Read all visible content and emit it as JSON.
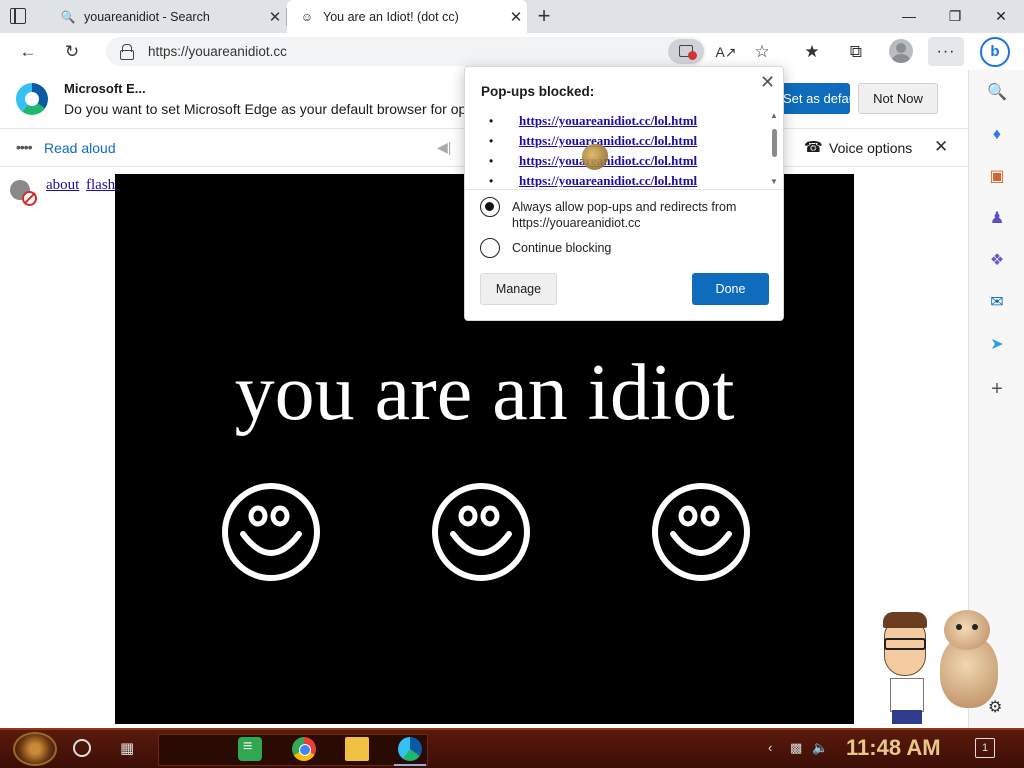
{
  "tabs": [
    {
      "title": "youareanidiot - Search",
      "favicon": "search-icon"
    },
    {
      "title": "You are an Idiot! (dot cc)",
      "favicon": "smiley-icon"
    }
  ],
  "address_bar": {
    "url": "https://youareanidiot.cc"
  },
  "infobar": {
    "title": "Microsoft E...",
    "message": "Do you want to set Microsoft Edge as your default browser for op",
    "set_default_label": "Set as default",
    "not_now_label": "Not Now"
  },
  "read_aloud": {
    "label": "Read aloud",
    "voice_options_label": "Voice options"
  },
  "page": {
    "links": [
      "about",
      "flash"
    ],
    "headline": "you are an idiot"
  },
  "popup": {
    "title": "Pop-ups blocked:",
    "blocked_urls": [
      "https://youareanidiot.cc/lol.html",
      "https://youareanidiot.cc/lol.html",
      "https://youareanidiot.cc/lol.html",
      "https://youareanidiot.cc/lol.html"
    ],
    "option_allow": "Always allow pop-ups and redirects from https://youareanidiot.cc",
    "option_block": "Continue blocking",
    "selected_option": "allow",
    "manage_label": "Manage",
    "done_label": "Done"
  },
  "taskbar": {
    "time": "11:48 AM",
    "notification_count": "1"
  },
  "colors": {
    "accent": "#0f6cbd",
    "stage_background": "#000000",
    "stage_text": "#ffffff"
  }
}
